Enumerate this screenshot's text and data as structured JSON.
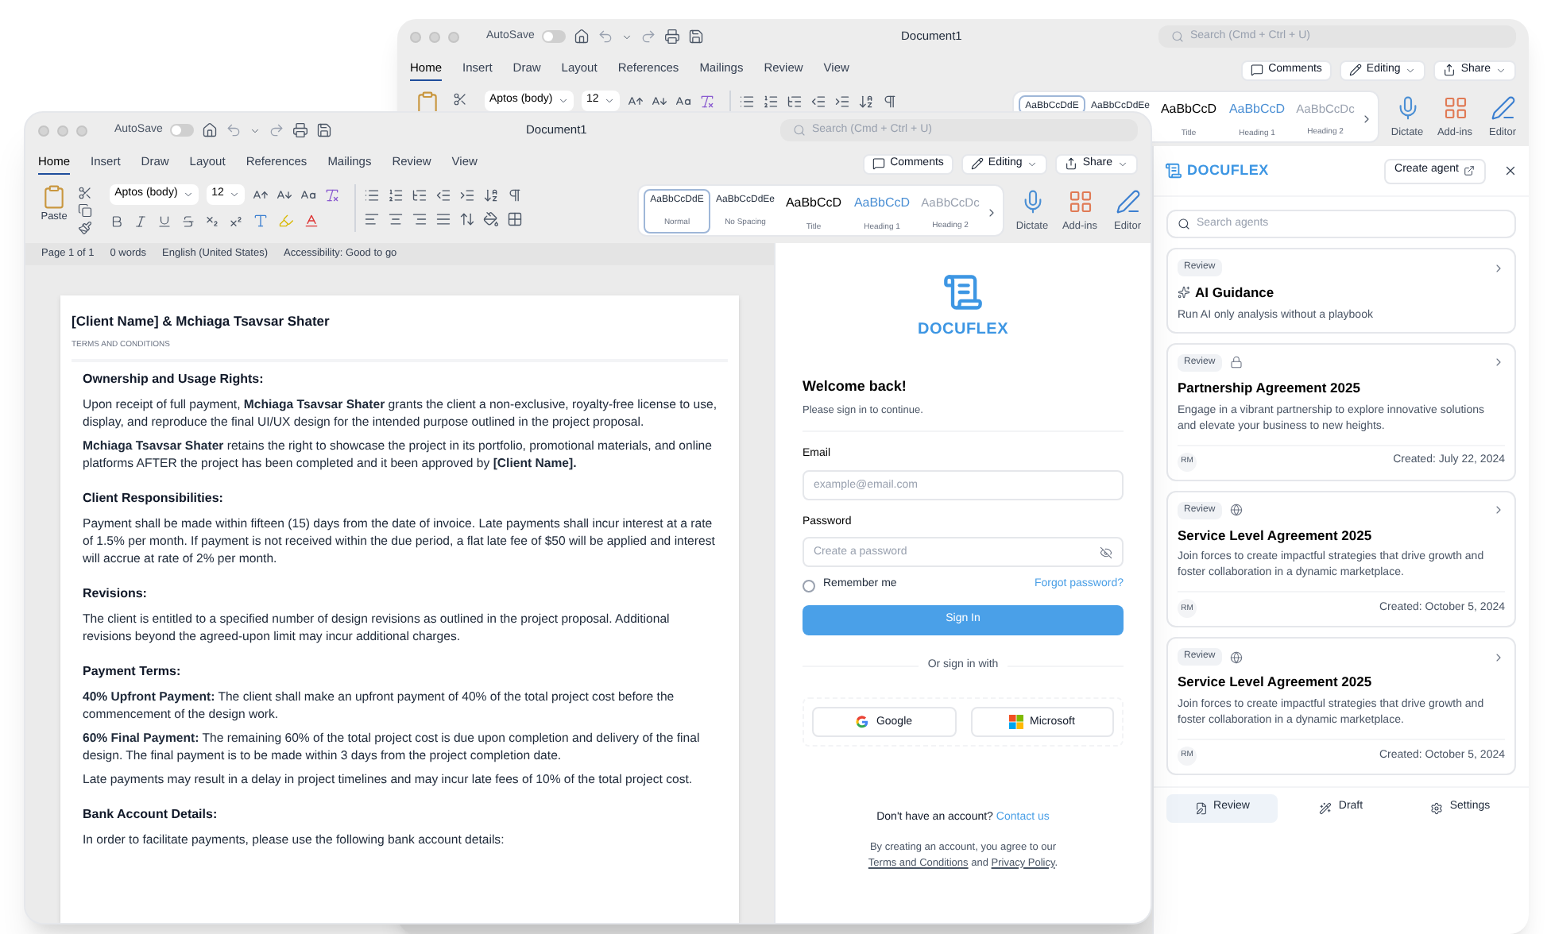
{
  "back_window": {
    "title": "Document1",
    "autosave": {
      "label": "AutoSave",
      "on": false
    },
    "search": {
      "placeholder": "Search (Cmd + Ctrl + U)"
    },
    "tabs": [
      {
        "label": "Home",
        "selected": true
      },
      {
        "label": "Insert",
        "selected": false
      },
      {
        "label": "Draw",
        "selected": false
      },
      {
        "label": "Layout",
        "selected": false
      },
      {
        "label": "References",
        "selected": false
      },
      {
        "label": "Mailings",
        "selected": false
      },
      {
        "label": "Review",
        "selected": false
      },
      {
        "label": "View",
        "selected": false
      }
    ],
    "actions": [
      {
        "label": "Comments",
        "kind": "comments"
      },
      {
        "label": "Editing",
        "kind": "editing"
      },
      {
        "label": "Share",
        "kind": "share"
      }
    ],
    "ribbon": {
      "font": "Aptos (body)",
      "size": "12",
      "styles": [
        {
          "sample": "AaBbCcDdE",
          "kind": "normal",
          "selected": true
        },
        {
          "sample": "AaBbCcDdEe",
          "kind": "nospacing",
          "selected": false
        },
        {
          "sample": "AaBbCcD",
          "label": "Title",
          "kind": "title",
          "selected": false
        },
        {
          "sample": "AaBbCcD",
          "label": "Heading 1",
          "kind": "heading1",
          "selected": false
        },
        {
          "sample": "AaBbCcDc",
          "label": "Heading 2",
          "kind": "heading2",
          "selected": false
        }
      ],
      "tools": [
        {
          "label": "Dictate",
          "kind": "dictate"
        },
        {
          "label": "Add-ins",
          "kind": "addins"
        },
        {
          "label": "Editor",
          "kind": "editor"
        }
      ]
    },
    "addin": {
      "brand": "DOCUFLEX",
      "create": "Create agent",
      "search": {
        "placeholder": "Search agents"
      },
      "agents": [
        {
          "kind": "guidance",
          "tag": "Review",
          "title": "AI Guidance",
          "description": "Run AI only analysis without a playbook"
        },
        {
          "kind": "private",
          "tag": "Review",
          "title": "Partnership Agreement 2025",
          "description": "Engage in a vibrant partnership to explore innovative solutions and elevate your business to new heights.",
          "owner": "RM",
          "created": "Created: July 22, 2024"
        },
        {
          "kind": "public",
          "tag": "Review",
          "title": "Service Level Agreement 2025",
          "description": "Join forces to create impactful strategies that drive growth and foster collaboration in a dynamic marketplace.",
          "owner": "RM",
          "created": "Created: October 5, 2024"
        },
        {
          "kind": "public",
          "tag": "Review",
          "title": "Service Level Agreement 2025",
          "description": "Join forces to create impactful strategies that drive growth and foster collaboration in a dynamic marketplace.",
          "owner": "RM",
          "created": "Created: October 5, 2024"
        }
      ],
      "nav": [
        {
          "label": "Review",
          "kind": "review",
          "selected": true
        },
        {
          "label": "Draft",
          "kind": "draft",
          "selected": false
        },
        {
          "label": "Settings",
          "kind": "settings",
          "selected": false
        }
      ]
    }
  },
  "front_window": {
    "title": "Document1",
    "autosave": {
      "label": "AutoSave",
      "on": false
    },
    "search": {
      "placeholder": "Search (Cmd + Ctrl + U)"
    },
    "tabs": [
      {
        "label": "Home",
        "selected": true
      },
      {
        "label": "Insert",
        "selected": false
      },
      {
        "label": "Draw",
        "selected": false
      },
      {
        "label": "Layout",
        "selected": false
      },
      {
        "label": "References",
        "selected": false
      },
      {
        "label": "Mailings",
        "selected": false
      },
      {
        "label": "Review",
        "selected": false
      },
      {
        "label": "View",
        "selected": false
      }
    ],
    "actions": [
      {
        "label": "Comments",
        "kind": "comments"
      },
      {
        "label": "Editing",
        "kind": "editing"
      },
      {
        "label": "Share",
        "kind": "share"
      }
    ],
    "ribbon": {
      "paste": "Paste",
      "font": "Aptos (body)",
      "size": "12",
      "styles": [
        {
          "sample": "AaBbCcDdE",
          "label": "Normal",
          "kind": "normal",
          "selected": true
        },
        {
          "sample": "AaBbCcDdEe",
          "label": "No Spacing",
          "kind": "nospacing",
          "selected": false
        },
        {
          "sample": "AaBbCcD",
          "label": "Title",
          "kind": "title",
          "selected": false
        },
        {
          "sample": "AaBbCcD",
          "label": "Heading 1",
          "kind": "heading1",
          "selected": false
        },
        {
          "sample": "AaBbCcDc",
          "label": "Heading 2",
          "kind": "heading2",
          "selected": false
        }
      ],
      "tools": [
        {
          "label": "Dictate",
          "kind": "dictate"
        },
        {
          "label": "Add-ins",
          "kind": "addins"
        },
        {
          "label": "Editor",
          "kind": "editor"
        }
      ]
    },
    "status_bar": [
      "Page 1 of 1",
      "0 words",
      "English (United States)",
      "Accessibility: Good to go"
    ],
    "document": {
      "title": "[Client Name] & Mchiaga Tsavsar Shater",
      "subtitle": "TERMS AND CONDITIONS",
      "sections": [
        {
          "heading": "Ownership and Usage Rights:",
          "paragraphs": [
            "Upon receipt of full payment, **Mchiaga Tsavsar Shater** grants the client a non-exclusive, royalty-free license to use, display, and reproduce the final UI/UX design for the intended purpose outlined in the project proposal.",
            "**Mchiaga Tsavsar Shater** retains the right to showcase the project in its portfolio, promotional materials, and online platforms AFTER the project has been completed and it been approved by **[Client Name].**"
          ]
        },
        {
          "heading": "Client Responsibilities:",
          "paragraphs": [
            "Payment shall be made within fifteen (15) days from the date of invoice. Late payments shall incur interest at a rate of 1.5% per month. If payment is not received within the due period, a flat late fee of $50 will be applied and interest will accrue at rate of 2% per month."
          ]
        },
        {
          "heading": "Revisions:",
          "paragraphs": [
            "The client is entitled to a specified number of design revisions as outlined in the project proposal. Additional revisions beyond the agreed-upon limit may incur additional charges."
          ]
        },
        {
          "heading": "Payment Terms:",
          "paragraphs": [
            "**40% Upfront Payment:** The client shall make an upfront payment of 40% of the total project cost before the commencement of the design work.",
            "**60% Final Payment:** The remaining 60% of the total project cost is due upon completion and delivery of the final design. The final payment is to be made within 3 days from the project completion date.",
            "Late payments may result in a delay in project timelines and may incur late fees of 10% of the total project cost."
          ]
        },
        {
          "heading": "Bank Account Details:",
          "paragraphs": [
            "In order to facilitate payments, please use the following bank account details:"
          ]
        }
      ]
    },
    "login": {
      "brand": "DOCUFLEX",
      "heading": "Welcome back!",
      "subheading": "Please sign in to continue.",
      "email": {
        "label": "Email",
        "placeholder": "example@email.com"
      },
      "password": {
        "label": "Password",
        "placeholder": "Create a password"
      },
      "remember": {
        "label": "Remember me",
        "checked": false
      },
      "forgot": "Forgot password?",
      "submit": "Sign In",
      "divider": "Or sign in with",
      "providers": [
        {
          "label": "Google",
          "kind": "google"
        },
        {
          "label": "Microsoft",
          "kind": "microsoft"
        }
      ],
      "signup_prompt": "Don't have an account?",
      "signup_link": "Contact us",
      "legal": {
        "before": "By creating an account, you agree to our",
        "terms": "Terms and Conditions",
        "middle": "and",
        "privacy": "Privacy Policy",
        "after": "."
      }
    }
  }
}
